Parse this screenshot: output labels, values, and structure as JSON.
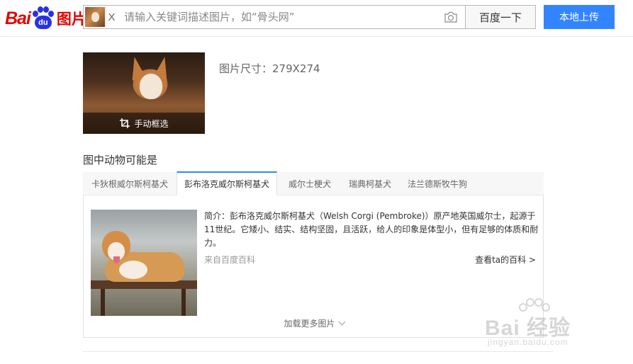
{
  "header": {
    "logo": {
      "bai": "Bai",
      "du": "du",
      "pic": "图片"
    },
    "search": {
      "clear_label": "X",
      "placeholder": "请输入关键词描述图片，如“骨头网”",
      "value": ""
    },
    "search_button": "百度一下",
    "upload_button": "本地上传"
  },
  "preview": {
    "crop_label": "手动框选",
    "size_text": "图片尺寸：279X274"
  },
  "section": {
    "title": "图中动物可能是"
  },
  "tabs": [
    {
      "label": "卡狄根威尔斯柯基犬",
      "active": false
    },
    {
      "label": "彭布洛克威尔斯柯基犬",
      "active": true
    },
    {
      "label": "威尔士梗犬",
      "active": false
    },
    {
      "label": "瑞典柯基犬",
      "active": false
    },
    {
      "label": "法兰德斯牧牛狗",
      "active": false
    }
  ],
  "card": {
    "description": "简介：彭布洛克威尔斯柯基犬（Welsh Corgi (Pembroke)）原产地英国威尔士，起源于11世纪。它矮小、结实、结构坚固，且活跃，给人的印象是体型小，但有足够的体质和耐力。",
    "source": "来自百度百科",
    "more_link": "查看ta的百科 >",
    "load_more": "加载更多图片"
  },
  "watermark": {
    "text": "Bai  经验",
    "sub": "jingyan.baidu.com"
  },
  "colors": {
    "brand_red": "#e10602",
    "brand_blue": "#2932e1",
    "accent": "#3385ff"
  }
}
